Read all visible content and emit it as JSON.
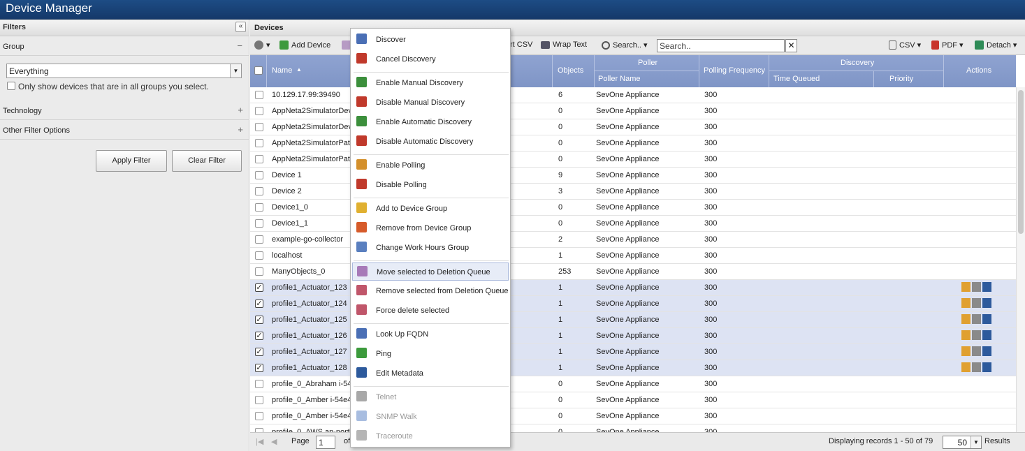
{
  "app": {
    "title": "Device Manager"
  },
  "filters": {
    "title": "Filters",
    "group_label": "Group",
    "group_sign": "−",
    "group_value": "Everything",
    "only_show": "Only show devices that are in all groups you select.",
    "technology": "Technology",
    "technology_sign": "+",
    "other": "Other Filter Options",
    "other_sign": "+",
    "apply": "Apply Filter",
    "clear": "Clear Filter"
  },
  "devices": {
    "title": "Devices",
    "toolbar": {
      "add": "Add Device",
      "csv_import": "rt CSV",
      "wrap": "Wrap Text",
      "search": "Search..",
      "search_placeholder": "Search..",
      "csv": "CSV",
      "pdf": "PDF",
      "detach": "Detach"
    },
    "columns": {
      "name": "Name",
      "objects": "Objects",
      "poller": "Poller",
      "poller_name": "Poller Name",
      "polling_frequency": "Polling Frequency",
      "discovery": "Discovery",
      "time_queued": "Time Queued",
      "priority": "Priority",
      "actions": "Actions"
    },
    "rows": [
      {
        "name": "10.129.17.99:39490",
        "objects": "6",
        "poller": "SevOne Appliance",
        "freq": "300",
        "selected": false
      },
      {
        "name": "AppNeta2SimulatorDev",
        "objects": "0",
        "poller": "SevOne Appliance",
        "freq": "300",
        "selected": false
      },
      {
        "name": "AppNeta2SimulatorDev",
        "objects": "0",
        "poller": "SevOne Appliance",
        "freq": "300",
        "selected": false
      },
      {
        "name": "AppNeta2SimulatorPath",
        "objects": "0",
        "poller": "SevOne Appliance",
        "freq": "300",
        "selected": false
      },
      {
        "name": "AppNeta2SimulatorPath",
        "objects": "0",
        "poller": "SevOne Appliance",
        "freq": "300",
        "selected": false
      },
      {
        "name": "Device 1",
        "objects": "9",
        "poller": "SevOne Appliance",
        "freq": "300",
        "selected": false
      },
      {
        "name": "Device 2",
        "objects": "3",
        "poller": "SevOne Appliance",
        "freq": "300",
        "selected": false
      },
      {
        "name": "Device1_0",
        "objects": "0",
        "poller": "SevOne Appliance",
        "freq": "300",
        "selected": false
      },
      {
        "name": "Device1_1",
        "objects": "0",
        "poller": "SevOne Appliance",
        "freq": "300",
        "selected": false
      },
      {
        "name": "example-go-collector",
        "objects": "2",
        "poller": "SevOne Appliance",
        "freq": "300",
        "selected": false
      },
      {
        "name": "localhost",
        "objects": "1",
        "poller": "SevOne Appliance",
        "freq": "300",
        "selected": false
      },
      {
        "name": "ManyObjects_0",
        "objects": "253",
        "poller": "SevOne Appliance",
        "freq": "300",
        "selected": false
      },
      {
        "name": "profile1_Actuator_123",
        "objects": "1",
        "poller": "SevOne Appliance",
        "freq": "300",
        "selected": true
      },
      {
        "name": "profile1_Actuator_124",
        "objects": "1",
        "poller": "SevOne Appliance",
        "freq": "300",
        "selected": true
      },
      {
        "name": "profile1_Actuator_125",
        "objects": "1",
        "poller": "SevOne Appliance",
        "freq": "300",
        "selected": true
      },
      {
        "name": "profile1_Actuator_126",
        "objects": "1",
        "poller": "SevOne Appliance",
        "freq": "300",
        "selected": true
      },
      {
        "name": "profile1_Actuator_127",
        "objects": "1",
        "poller": "SevOne Appliance",
        "freq": "300",
        "selected": true
      },
      {
        "name": "profile1_Actuator_128",
        "objects": "1",
        "poller": "SevOne Appliance",
        "freq": "300",
        "selected": true
      },
      {
        "name": "profile_0_Abraham i-54",
        "objects": "0",
        "poller": "SevOne Appliance",
        "freq": "300",
        "selected": false
      },
      {
        "name": "profile_0_Amber i-54e4",
        "objects": "0",
        "poller": "SevOne Appliance",
        "freq": "300",
        "selected": false
      },
      {
        "name": "profile_0_Amber i-54e4",
        "objects": "0",
        "poller": "SevOne Appliance",
        "freq": "300",
        "selected": false
      },
      {
        "name": "profile_0_AWS ap-north",
        "objects": "0",
        "poller": "SevOne Appliance",
        "freq": "300",
        "selected": false
      }
    ],
    "pager": {
      "page_label": "Page",
      "page": "1",
      "of": "of",
      "displaying": "Displaying records 1 - 50 of 79",
      "page_size": "50",
      "results": "Results"
    }
  },
  "context_menu": {
    "items": [
      {
        "label": "Discover",
        "icon": "discover-icon",
        "color": "#4a6fb5",
        "disabled": false,
        "highlight": false
      },
      {
        "label": "Cancel Discovery",
        "icon": "cancel-discovery-icon",
        "color": "#c0392b",
        "disabled": false,
        "highlight": false
      },
      {
        "sep": true
      },
      {
        "label": "Enable Manual Discovery",
        "icon": "enable-manual-discovery-icon",
        "color": "#3c8f3c",
        "disabled": false,
        "highlight": false
      },
      {
        "label": "Disable Manual Discovery",
        "icon": "disable-manual-discovery-icon",
        "color": "#c0392b",
        "disabled": false,
        "highlight": false
      },
      {
        "label": "Enable Automatic Discovery",
        "icon": "enable-auto-discovery-icon",
        "color": "#3c8f3c",
        "disabled": false,
        "highlight": false
      },
      {
        "label": "Disable Automatic Discovery",
        "icon": "disable-auto-discovery-icon",
        "color": "#c0392b",
        "disabled": false,
        "highlight": false
      },
      {
        "sep": true
      },
      {
        "label": "Enable Polling",
        "icon": "enable-polling-icon",
        "color": "#d4902c",
        "disabled": false,
        "highlight": false
      },
      {
        "label": "Disable Polling",
        "icon": "disable-polling-icon",
        "color": "#c0392b",
        "disabled": false,
        "highlight": false
      },
      {
        "sep": true
      },
      {
        "label": "Add to Device Group",
        "icon": "add-group-icon",
        "color": "#e0b030",
        "disabled": false,
        "highlight": false
      },
      {
        "label": "Remove from Device Group",
        "icon": "remove-group-icon",
        "color": "#d65b2a",
        "disabled": false,
        "highlight": false
      },
      {
        "label": "Change Work Hours Group",
        "icon": "work-hours-icon",
        "color": "#5a7fbf",
        "disabled": false,
        "highlight": false
      },
      {
        "sep": true
      },
      {
        "label": "Move selected to Deletion Queue",
        "icon": "deletion-queue-add-icon",
        "color": "#a77ab8",
        "disabled": false,
        "highlight": true
      },
      {
        "label": "Remove selected from Deletion Queue",
        "icon": "deletion-queue-remove-icon",
        "color": "#c0566a",
        "disabled": false,
        "highlight": false
      },
      {
        "label": "Force delete selected",
        "icon": "force-delete-icon",
        "color": "#c0566a",
        "disabled": false,
        "highlight": false
      },
      {
        "sep": true
      },
      {
        "label": "Look Up FQDN",
        "icon": "fqdn-icon",
        "color": "#4a6fb5",
        "disabled": false,
        "highlight": false
      },
      {
        "label": "Ping",
        "icon": "ping-icon",
        "color": "#3c9a3c",
        "disabled": false,
        "highlight": false
      },
      {
        "label": "Edit Metadata",
        "icon": "metadata-icon",
        "color": "#2d5a9c",
        "disabled": false,
        "highlight": false
      },
      {
        "sep": true
      },
      {
        "label": "Telnet",
        "icon": "telnet-icon",
        "color": "#a8a8a8",
        "disabled": true,
        "highlight": false
      },
      {
        "label": "SNMP Walk",
        "icon": "snmp-walk-icon",
        "color": "#a8bde0",
        "disabled": true,
        "highlight": false
      },
      {
        "label": "Traceroute",
        "icon": "traceroute-icon",
        "color": "#b5b5b5",
        "disabled": true,
        "highlight": false
      }
    ]
  }
}
